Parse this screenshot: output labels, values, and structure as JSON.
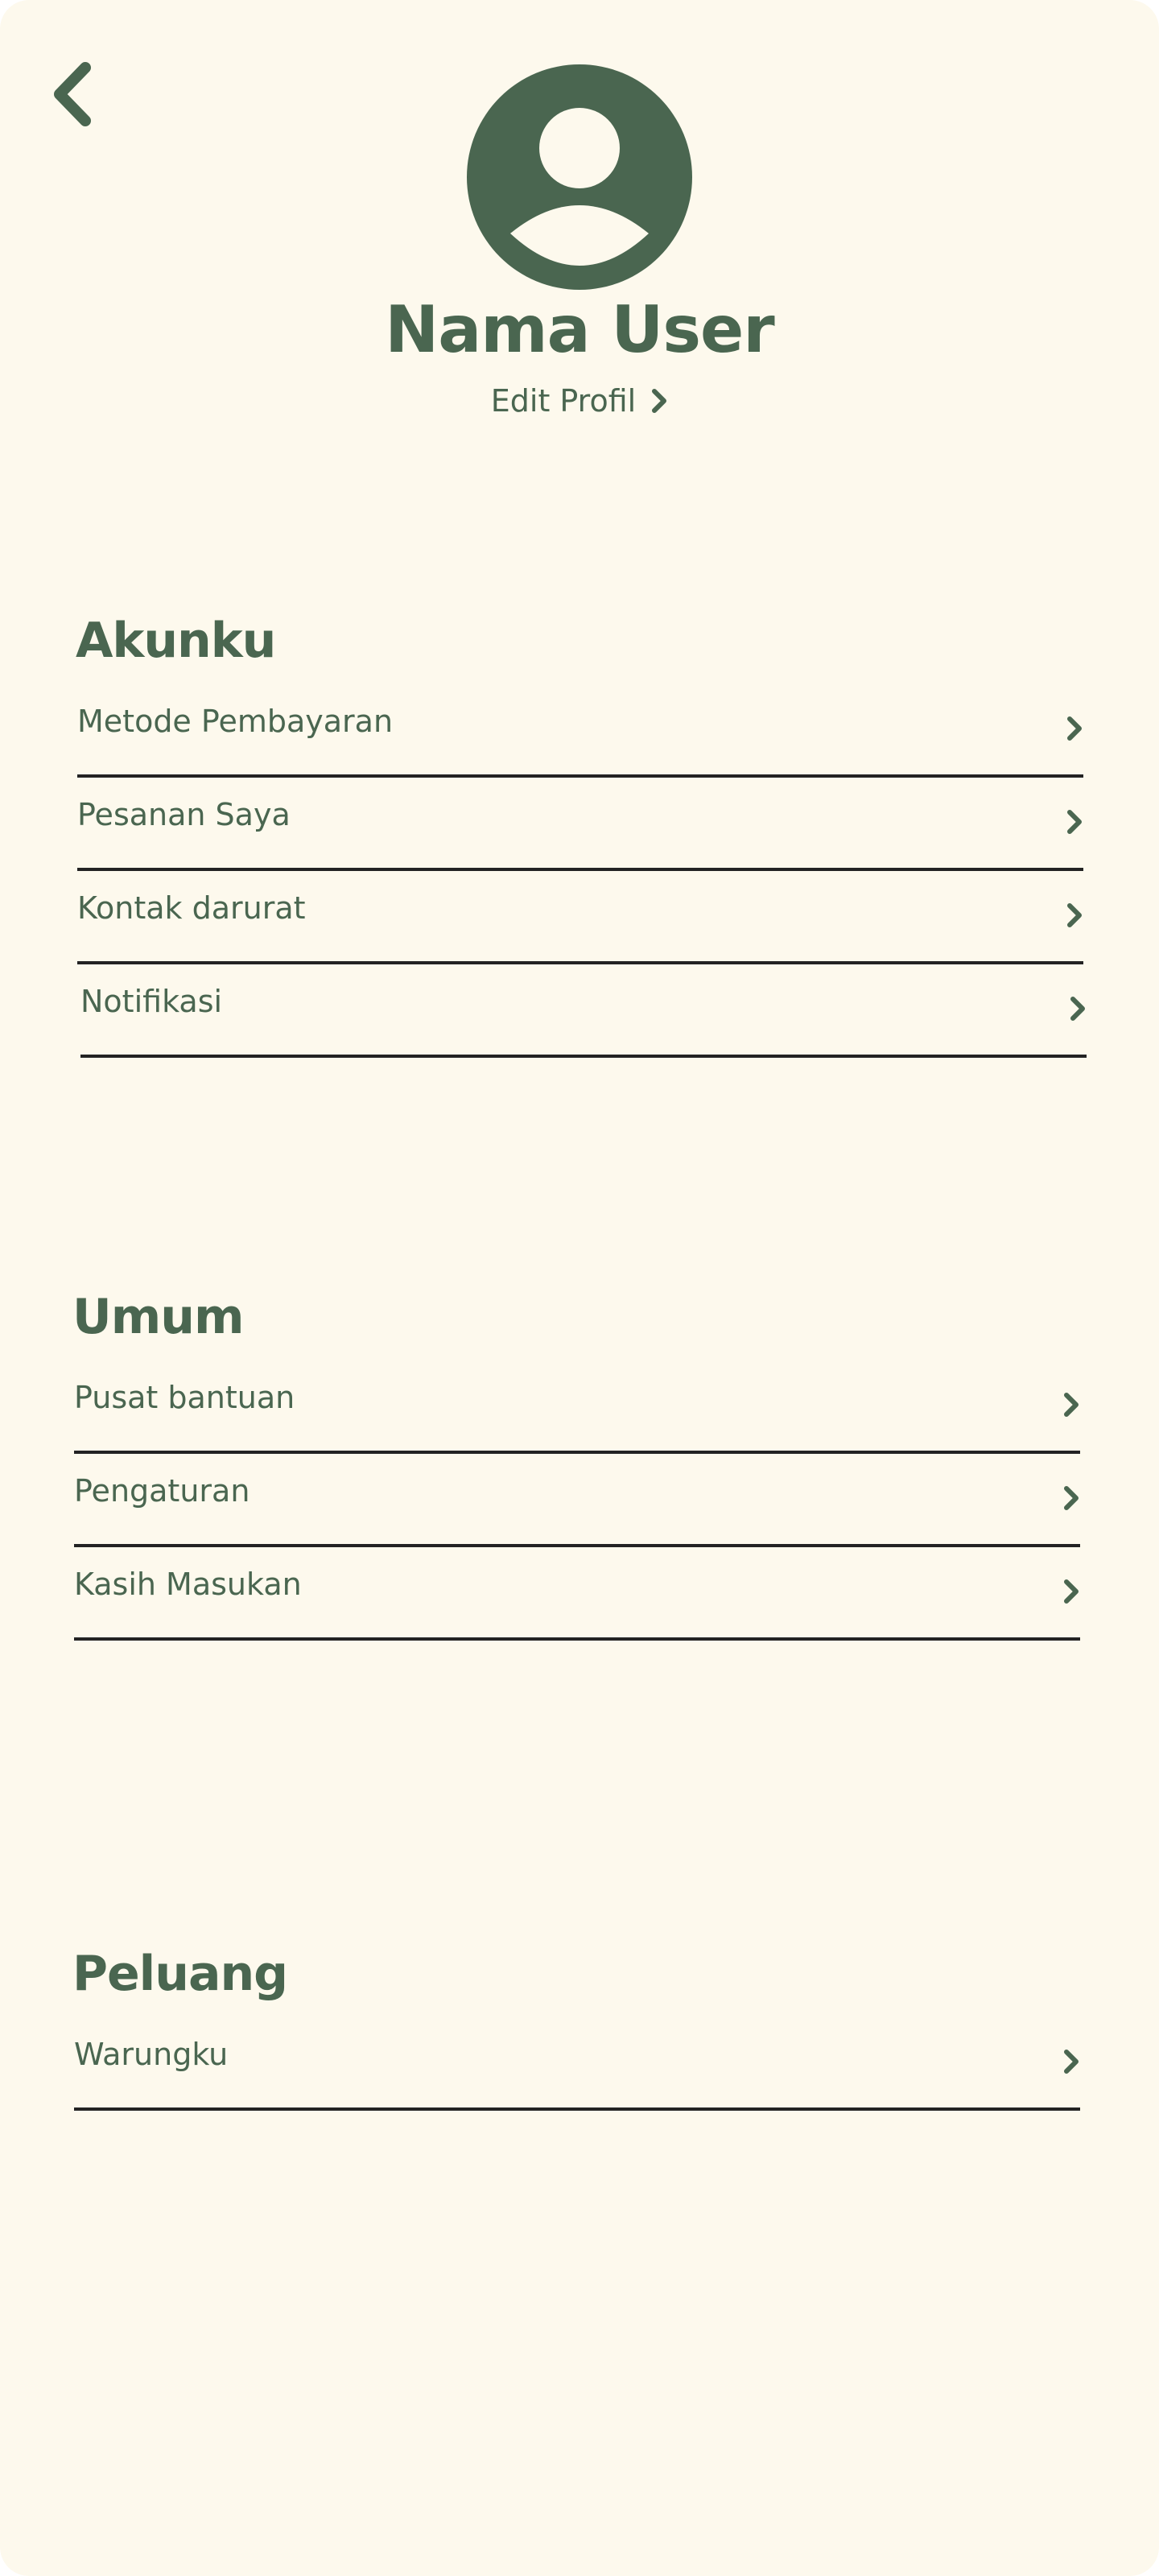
{
  "header": {
    "back_icon": "chevron-left-icon",
    "avatar_icon": "user-avatar-icon",
    "user_name": "Nama User",
    "edit_profile_label": "Edit Profil",
    "edit_profile_icon": "chevron-right-icon"
  },
  "colors": {
    "primary": "#4a6650",
    "background": "#fdf9ed",
    "divider": "#232323"
  },
  "sections": {
    "akunku": {
      "title": "Akunku",
      "items": [
        {
          "label": "Metode Pembayaran"
        },
        {
          "label": "Pesanan Saya"
        },
        {
          "label": "Kontak darurat"
        },
        {
          "label": "Notifikasi"
        }
      ]
    },
    "umum": {
      "title": "Umum",
      "items": [
        {
          "label": "Pusat bantuan"
        },
        {
          "label": "Pengaturan"
        },
        {
          "label": "Kasih Masukan"
        }
      ]
    },
    "peluang": {
      "title": "Peluang",
      "items": [
        {
          "label": "Warungku"
        }
      ]
    }
  }
}
